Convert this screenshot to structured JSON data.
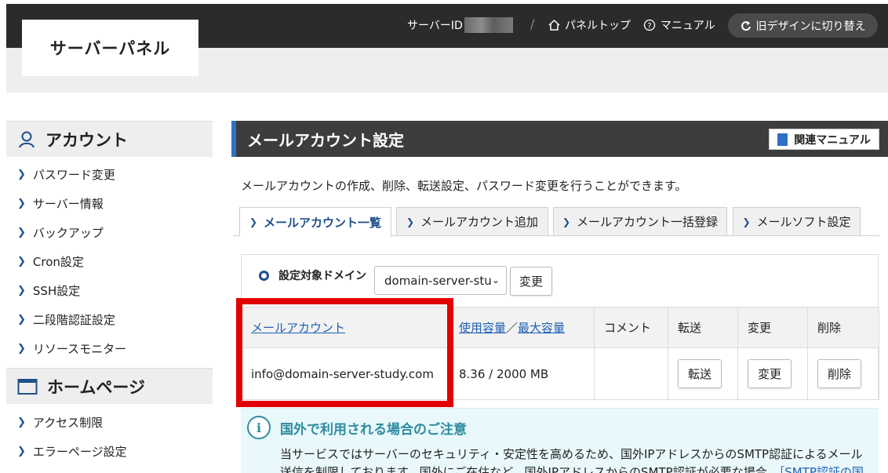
{
  "header": {
    "logo": "サーバーパネル",
    "server_id_label": "サーバーID",
    "separator": "/",
    "panel_top": "パネルトップ",
    "manual": "マニュアル",
    "old_design": "旧デザインに切り替え"
  },
  "sidebar": {
    "account_heading": "アカウント",
    "account_items": [
      {
        "label": "パスワード変更"
      },
      {
        "label": "サーバー情報"
      },
      {
        "label": "バックアップ"
      },
      {
        "label": "Cron設定"
      },
      {
        "label": "SSH設定"
      },
      {
        "label": "二段階認証設定"
      },
      {
        "label": "リソースモニター"
      }
    ],
    "homepage_heading": "ホームページ",
    "homepage_items": [
      {
        "label": "アクセス制限"
      },
      {
        "label": "エラーページ設定"
      }
    ]
  },
  "main": {
    "title": "メールアカウント設定",
    "manual_button": "関連マニュアル",
    "description": "メールアカウントの作成、削除、転送設定、パスワード変更を行うことができます。",
    "tabs": [
      {
        "label": "メールアカウント一覧",
        "active": true
      },
      {
        "label": "メールアカウント追加",
        "active": false
      },
      {
        "label": "メールアカウント一括登録",
        "active": false
      },
      {
        "label": "メールソフト設定",
        "active": false
      }
    ],
    "domain_label": "設定対象ドメイン",
    "domain_value": "domain-server-stu",
    "domain_change_button": "変更",
    "table": {
      "headers": {
        "account": "メールアカウント",
        "usage": "使用容量",
        "usage_sep": "／",
        "max": "最大容量",
        "comment": "コメント",
        "forward": "転送",
        "change": "変更",
        "delete": "削除"
      },
      "rows": [
        {
          "account": "info@domain-server-study.com",
          "usage": "8.36 / 2000 MB",
          "comment": "",
          "forward_button": "転送",
          "change_button": "変更",
          "delete_button": "削除"
        }
      ]
    },
    "notice": {
      "icon_glyph": "i",
      "title": "国外で利用される場合のご注意",
      "text": "当サービスではサーバーのセキュリティ・安定性を高めるため、国外IPアドレスからのSMTP認証によるメール送信を制限しております。国外にご在住など、国外IPアドレスからのSMTP認証が必要な場合、",
      "link": "［SMTP認証の国"
    }
  },
  "colors": {
    "header_bg": "#2b2b2b",
    "accent_blue": "#2f72c4",
    "link": "#1d5fb4",
    "highlight_red": "#e30000",
    "notice_teal": "#2f8ca0"
  }
}
